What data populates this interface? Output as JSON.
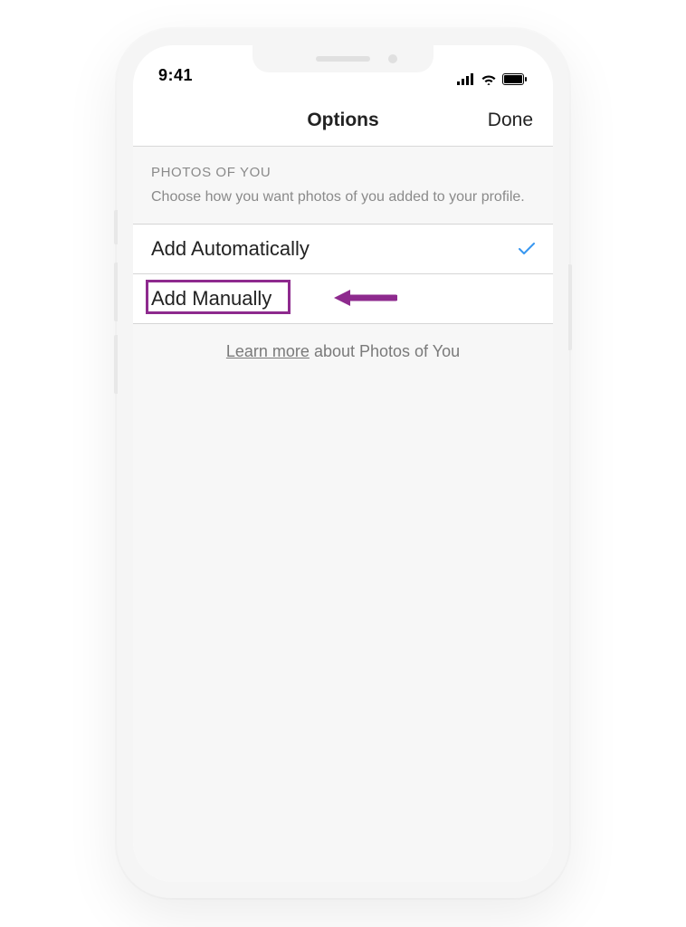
{
  "statusBar": {
    "time": "9:41"
  },
  "nav": {
    "title": "Options",
    "done": "Done"
  },
  "section": {
    "header": "PHOTOS OF YOU",
    "description": "Choose how you want photos of you added to your profile."
  },
  "options": {
    "automatic": "Add Automatically",
    "manual": "Add Manually"
  },
  "footer": {
    "linkText": "Learn more",
    "suffix": " about Photos of You"
  },
  "annotation": {
    "highlightColor": "#8e2a8e"
  }
}
